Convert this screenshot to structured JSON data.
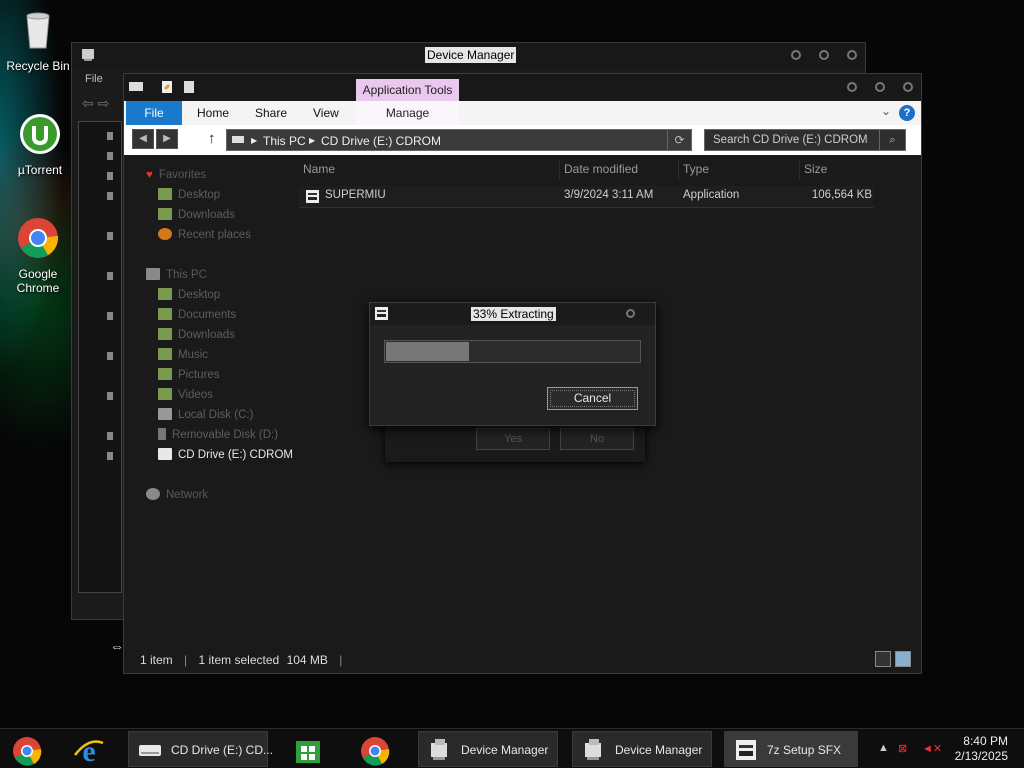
{
  "desktop": {
    "icons": [
      {
        "label": "Recycle Bin"
      },
      {
        "label": "µTorrent"
      },
      {
        "label": "Google Chrome"
      }
    ]
  },
  "device_manager": {
    "title": "Device Manager",
    "menu_file": "File"
  },
  "explorer": {
    "tabs": {
      "file": "File",
      "home": "Home",
      "share": "Share",
      "view": "View",
      "app_tools": "Application Tools",
      "manage": "Manage"
    },
    "address": {
      "crumbs": [
        "This PC",
        "CD Drive (E:) CDROM"
      ]
    },
    "search": {
      "placeholder": "Search CD Drive (E:) CDROM"
    },
    "nav": {
      "favorites": "Favorites",
      "fav_items": [
        "Desktop",
        "Downloads",
        "Recent places"
      ],
      "this_pc": "This PC",
      "pc_items": [
        "Desktop",
        "Documents",
        "Downloads",
        "Music",
        "Pictures",
        "Videos",
        "Local Disk (C:)",
        "Removable Disk (D:)",
        "CD Drive (E:) CDROM"
      ],
      "network": "Network"
    },
    "columns": {
      "name": "Name",
      "date": "Date modified",
      "type": "Type",
      "size": "Size"
    },
    "files": [
      {
        "name": "SUPERMIU",
        "date": "3/9/2024 3:11 AM",
        "type": "Application",
        "size": "106,564 KB"
      }
    ],
    "status": {
      "items": "1 item",
      "selected": "1 item selected",
      "size": "104 MB"
    }
  },
  "back_dialog": {
    "yes": "Yes",
    "no": "No"
  },
  "extract_dialog": {
    "title": "33% Extracting",
    "progress_percent": 33,
    "cancel": "Cancel"
  },
  "taskbar": {
    "buttons": [
      {
        "label": "CD Drive (E:) CD..."
      },
      {
        "label": "Device Manager"
      },
      {
        "label": "Device Manager"
      },
      {
        "label": "7z Setup SFX"
      }
    ],
    "time": "8:40 PM",
    "date": "2/13/2025"
  }
}
